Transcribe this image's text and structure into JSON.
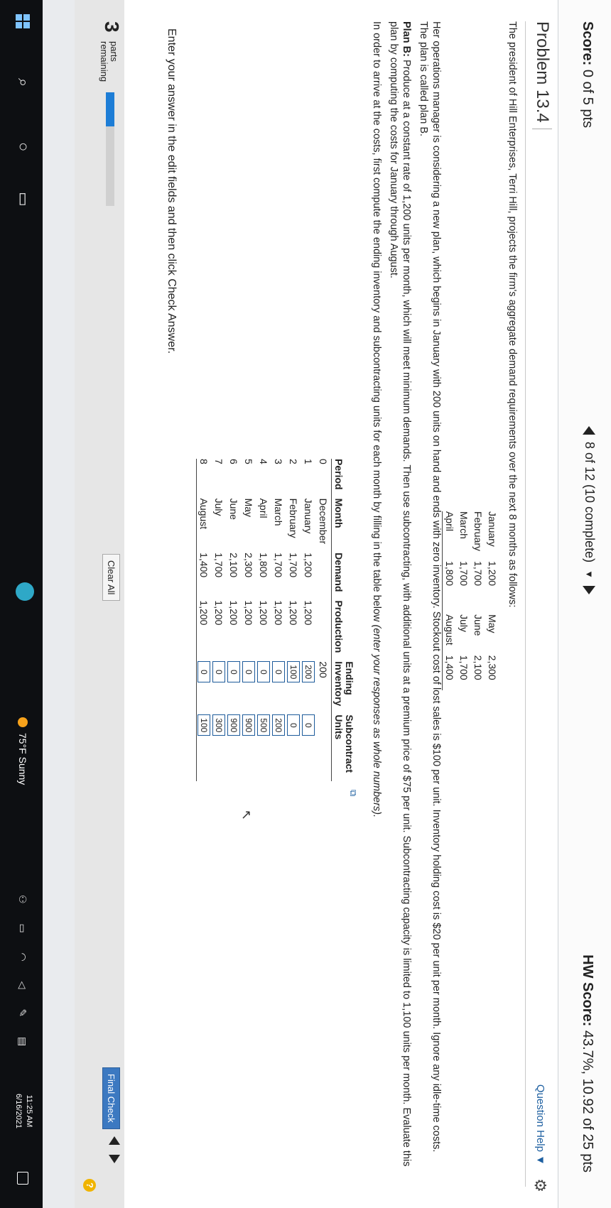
{
  "header": {
    "score_label": "Score:",
    "score_value": "0 of 5 pts",
    "question_nav": "8 of 12 (10 complete)",
    "hw_label": "HW Score:",
    "hw_value": "43.7%, 10.92 of 25 pts"
  },
  "problem": {
    "title": "Problem 13.4",
    "question_help": "Question Help",
    "intro": "The president of Hill Enterprises, Terri Hill, projects the firm's aggregate demand requirements over the next 8 months as follows:",
    "demand_left": [
      {
        "month": "January",
        "value": "1,200"
      },
      {
        "month": "February",
        "value": "1,700"
      },
      {
        "month": "March",
        "value": "1,700"
      },
      {
        "month": "April",
        "value": "1,800"
      }
    ],
    "demand_right": [
      {
        "month": "May",
        "value": "2,300"
      },
      {
        "month": "June",
        "value": "2,100"
      },
      {
        "month": "July",
        "value": "1,700"
      },
      {
        "month": "August",
        "value": "1,400"
      }
    ],
    "para_plan": "Her operations manager is considering a new plan, which begins in January with 200 units on hand and ends with zero inventory. Stockout cost of lost sales is $100 per unit. Inventory holding cost is $20 per unit per month. Ignore any idle-time costs. The plan is called plan B.",
    "planb_label": "Plan B:",
    "planb_text": " Produce at a constant rate of 1,200 units per month, which will meet minimum demands. Then use subcontracting, with additional units at a premium price of $75 per unit. Subcontracting capacity is limited to 1,100 units per month. Evaluate this plan by computing the costs for January through August.",
    "instruction": "In order to arrive at the costs, first compute the ending inventory and subcontracting units for each month by filling in the table below ",
    "instruction_italic": "(enter your responses as whole numbers).",
    "footnote": "Enter your answer in the edit fields and then click Check Answer."
  },
  "table": {
    "headers": {
      "period": "Period",
      "month": "Month",
      "demand": "Demand",
      "production": "Production",
      "ending_top": "Ending",
      "ending_bottom": "Inventory",
      "sub_top": "Subcontract",
      "sub_bottom": "Units"
    },
    "rows": [
      {
        "period": "0",
        "month": "December",
        "demand": "",
        "production": "",
        "ending": "200",
        "sub": ""
      },
      {
        "period": "1",
        "month": "January",
        "demand": "1,200",
        "production": "1,200",
        "ending": "200",
        "sub": "0"
      },
      {
        "period": "2",
        "month": "February",
        "demand": "1,700",
        "production": "1,200",
        "ending": "100",
        "sub": "0"
      },
      {
        "period": "3",
        "month": "March",
        "demand": "1,700",
        "production": "1,200",
        "ending": "0",
        "sub": "200"
      },
      {
        "period": "4",
        "month": "April",
        "demand": "1,800",
        "production": "1,200",
        "ending": "0",
        "sub": "500"
      },
      {
        "period": "5",
        "month": "May",
        "demand": "2,300",
        "production": "1,200",
        "ending": "0",
        "sub": "900"
      },
      {
        "period": "6",
        "month": "June",
        "demand": "2,100",
        "production": "1,200",
        "ending": "0",
        "sub": "900"
      },
      {
        "period": "7",
        "month": "July",
        "demand": "1,700",
        "production": "1,200",
        "ending": "0",
        "sub": "300"
      },
      {
        "period": "8",
        "month": "August",
        "demand": "1,400",
        "production": "1,200",
        "ending": "0",
        "sub": "100"
      }
    ]
  },
  "footer": {
    "parts_count": "3",
    "parts_label": "parts",
    "remaining_label": "remaining",
    "progress_fraction": 0.3,
    "clear_all": "Clear All",
    "final_check": "Final Check"
  },
  "taskbar": {
    "weather": "75°F Sunny",
    "time": "11:25 AM",
    "date": "6/16/2021"
  },
  "colors": {
    "accent": "#1d7dd6",
    "input_border": "#1c5a9a",
    "final_check_bg": "#3c79c1"
  }
}
